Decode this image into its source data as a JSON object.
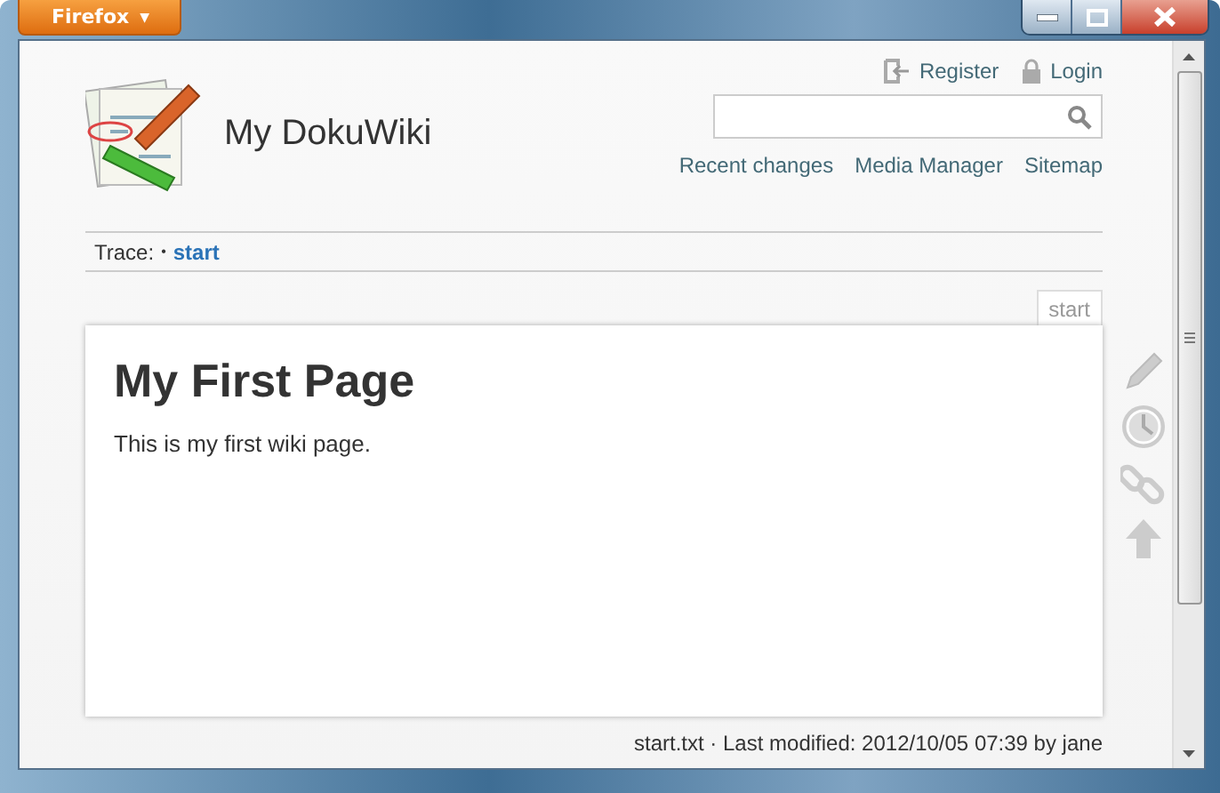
{
  "browser": {
    "menu_button": "Firefox",
    "menu_caret": "▼"
  },
  "site": {
    "title": "My DokuWiki"
  },
  "user_tools": [
    {
      "kind": "register",
      "label": "Register"
    },
    {
      "kind": "login",
      "label": "Login"
    }
  ],
  "site_tools": [
    "Recent changes",
    "Media Manager",
    "Sitemap"
  ],
  "breadcrumbs": {
    "label": "Trace:",
    "separator": "•",
    "items": [
      "start"
    ]
  },
  "page": {
    "id_tab": "start",
    "heading": "My First Page",
    "text": "This is my first wiki page."
  },
  "page_tools": [
    {
      "kind": "edit"
    },
    {
      "kind": "revisions"
    },
    {
      "kind": "backlinks"
    },
    {
      "kind": "top"
    }
  ],
  "footer": "start.txt · Last modified: 2012/10/05 07:39 by jane"
}
